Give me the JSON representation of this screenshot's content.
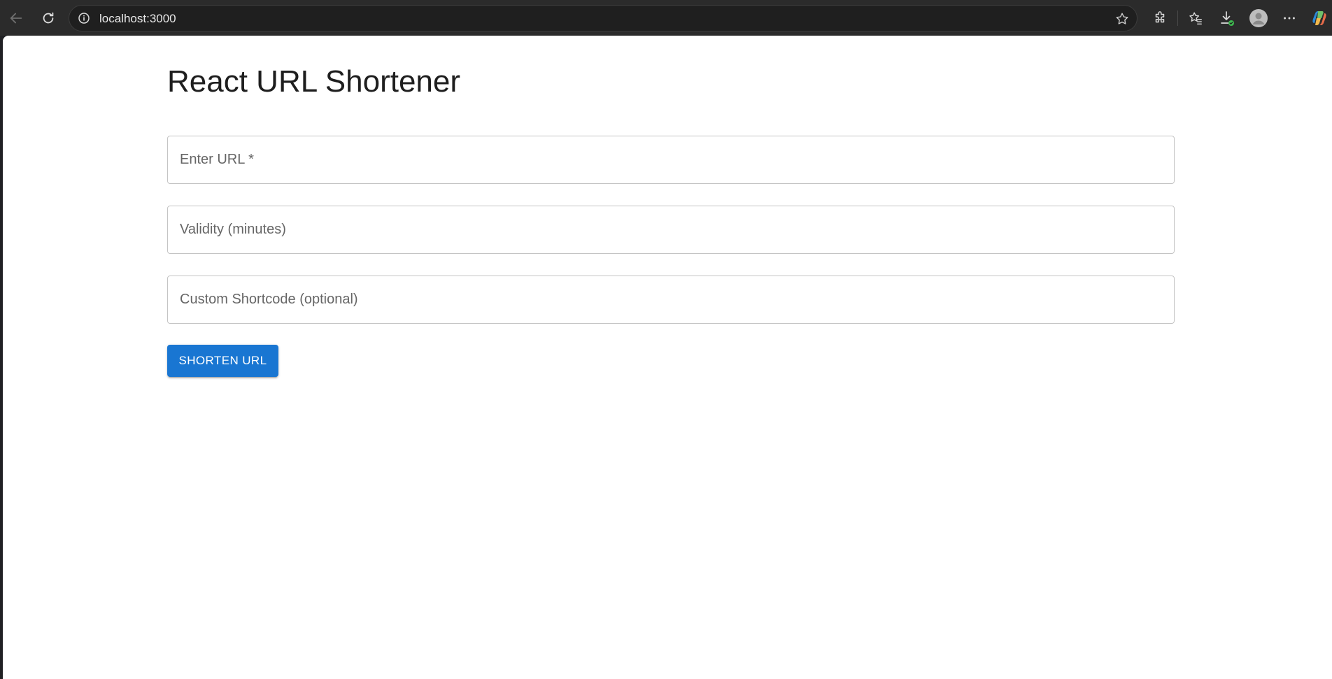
{
  "browser": {
    "address": "localhost:3000",
    "icons": [
      "back-arrow-icon",
      "refresh-icon",
      "site-info-icon",
      "favorite-star-icon",
      "extensions-icon",
      "favorites-icon",
      "downloads-icon",
      "profile-avatar-icon",
      "more-options-icon",
      "copilot-icon"
    ]
  },
  "page": {
    "title": "React URL Shortener",
    "fields": {
      "url_placeholder": "Enter URL *",
      "validity_placeholder": "Validity (minutes)",
      "shortcode_placeholder": "Custom Shortcode (optional)"
    },
    "submit_label": "SHORTEN URL"
  },
  "colors": {
    "primary": "#1976d2",
    "chrome_bg": "#2b2b2b",
    "page_bg": "#ffffff"
  }
}
